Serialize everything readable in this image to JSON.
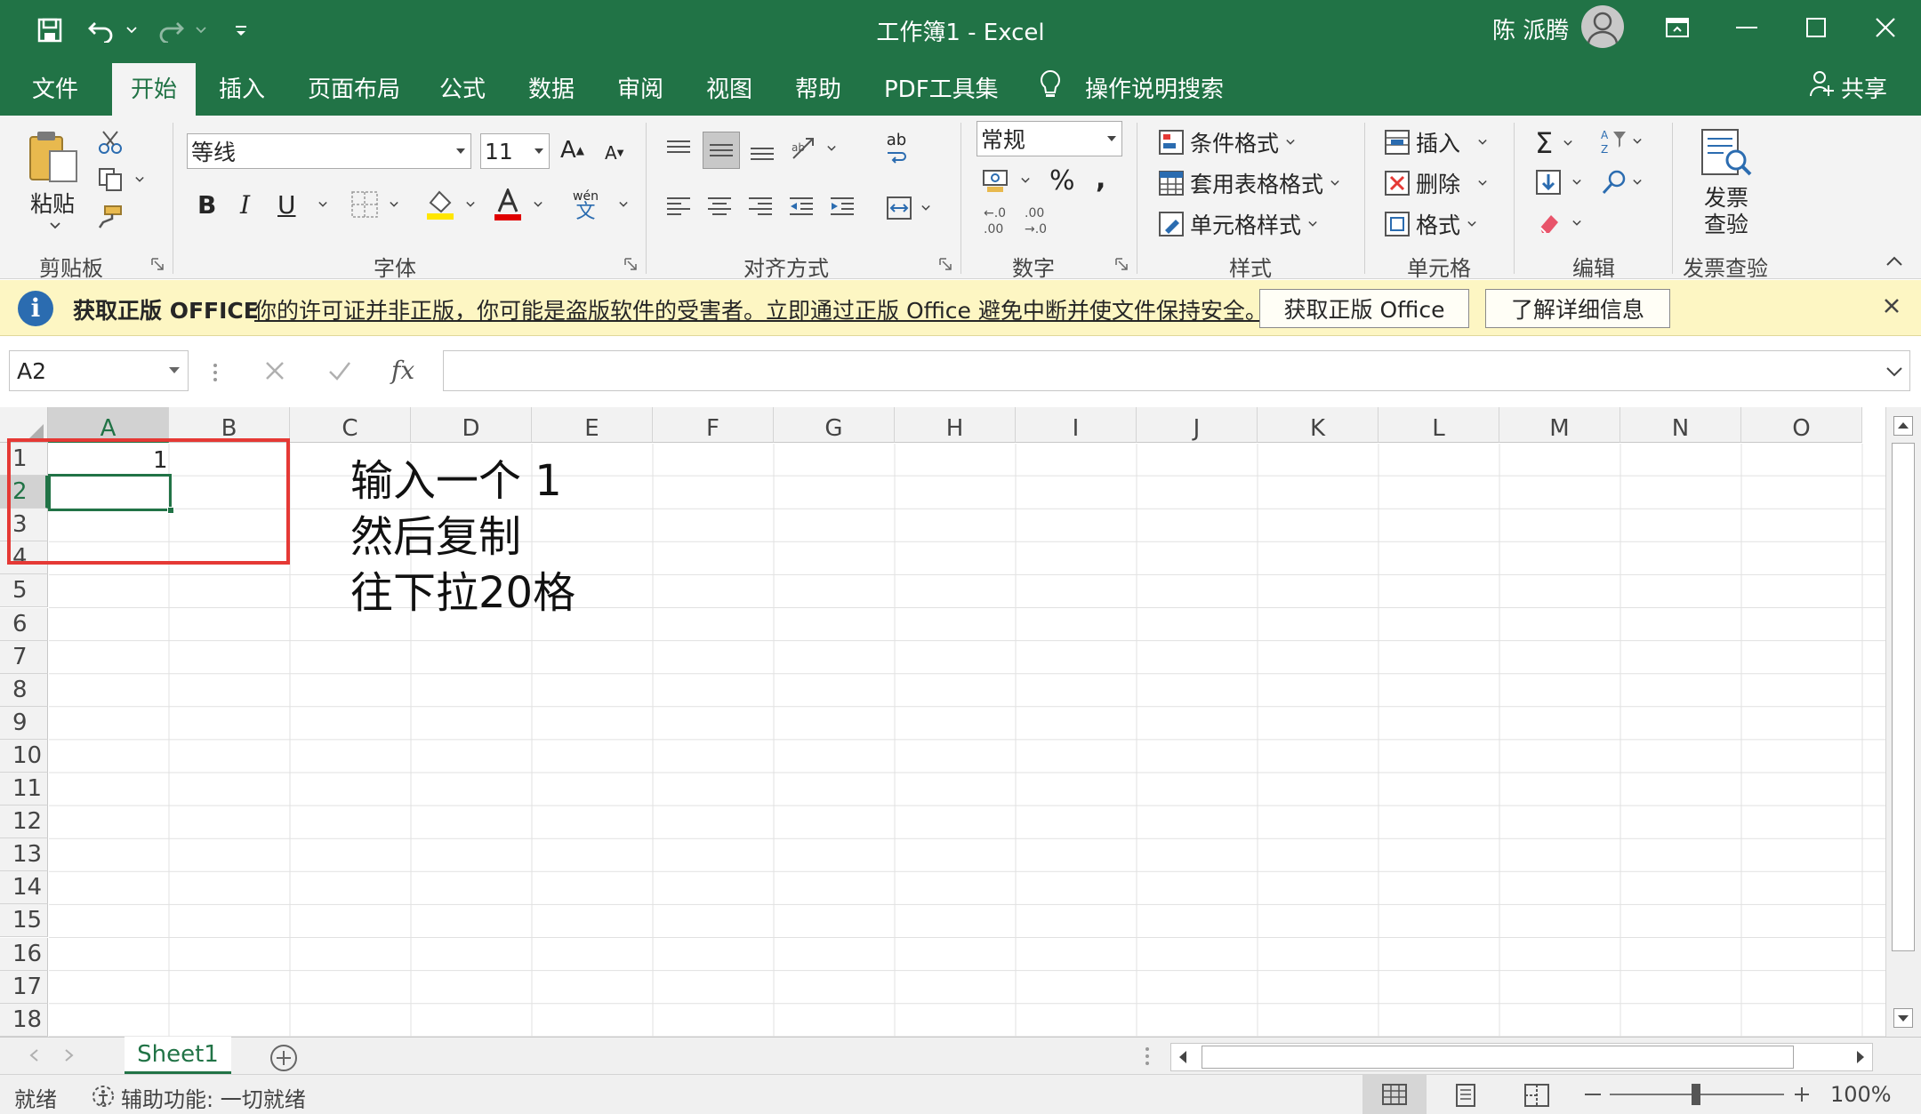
{
  "window": {
    "title": "工作簿1  -  Excel",
    "user_name": "陈 派腾"
  },
  "ribbon_tabs": [
    "文件",
    "开始",
    "插入",
    "页面布局",
    "公式",
    "数据",
    "审阅",
    "视图",
    "帮助",
    "PDF工具集"
  ],
  "active_tab": "开始",
  "search_label": "操作说明搜索",
  "share_label": "共享",
  "clipboard": {
    "paste_label": "粘贴",
    "group_label": "剪贴板"
  },
  "font": {
    "name": "等线",
    "size": "11",
    "group_label": "字体",
    "bold": "B",
    "italic": "I",
    "underline": "U",
    "grow": "A",
    "shrink": "A",
    "phonetic_top": "wén",
    "phonetic_bottom": "文"
  },
  "alignment": {
    "group_label": "对齐方式",
    "wrap": "ab"
  },
  "number": {
    "format": "常规",
    "group_label": "数字",
    "percent": "%",
    "comma": ","
  },
  "styles": {
    "group_label": "样式",
    "conditional": "条件格式",
    "table": "套用表格格式",
    "cell_styles": "单元格样式"
  },
  "cells_group": {
    "group_label": "单元格",
    "insert": "插入",
    "delete": "删除",
    "format": "格式"
  },
  "editing": {
    "group_label": "编辑"
  },
  "invoice": {
    "button_line1": "发票",
    "button_line2": "查验",
    "group_label": "发票查验"
  },
  "message_bar": {
    "title": "获取正版 OFFICE",
    "text": "你的许可证并非正版，你可能是盗版软件的受害者。立即通过正版 Office 避免中断并使文件保持安全。",
    "button_get": "获取正版 Office",
    "button_learn": "了解详细信息"
  },
  "formula_bar": {
    "name_box": "A2",
    "fx": "fx",
    "formula": ""
  },
  "columns": [
    "A",
    "B",
    "C",
    "D",
    "E",
    "F",
    "G",
    "H",
    "I",
    "J",
    "K",
    "L",
    "M",
    "N",
    "O"
  ],
  "rows": [
    "1",
    "2",
    "3",
    "4",
    "5",
    "6",
    "7",
    "8",
    "9",
    "10",
    "11",
    "12",
    "13",
    "14",
    "15",
    "16",
    "17",
    "18"
  ],
  "active_cell": "A2",
  "cells": {
    "A1": "1"
  },
  "annotation": {
    "line1": "输入一个 1",
    "line2": "然后复制",
    "line3": "往下拉20格"
  },
  "sheet": {
    "tab": "Sheet1"
  },
  "status": {
    "ready": "就绪",
    "accessibility": "辅助功能: 一切就绪",
    "zoom": "100%"
  },
  "colors": {
    "brand": "#217346",
    "annotation_border": "#e53935",
    "message_bg": "#fdf6c3"
  }
}
